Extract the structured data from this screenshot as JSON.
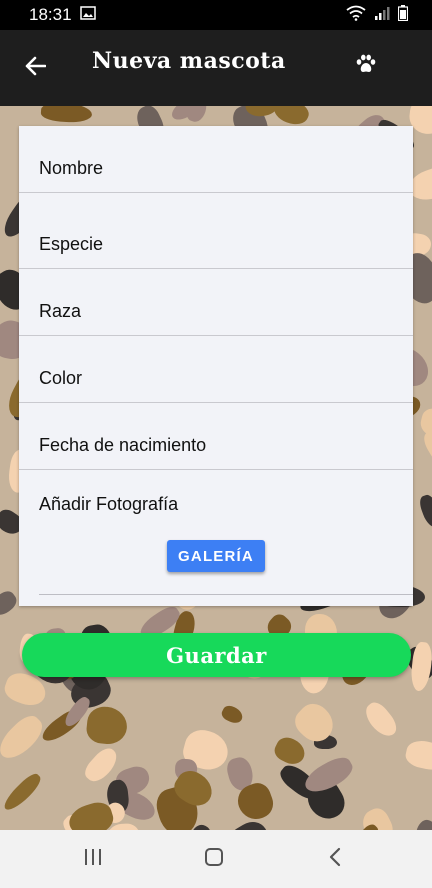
{
  "status_bar": {
    "time": "18:31",
    "icons": [
      "image-icon",
      "wifi-icon",
      "signal-icon",
      "battery-icon"
    ]
  },
  "app_bar": {
    "title": "Nueva mascota",
    "back_icon": "back-arrow-icon",
    "action_icon": "paw-icon"
  },
  "form": {
    "fields": [
      {
        "label": "Nombre"
      },
      {
        "label": "Especie"
      },
      {
        "label": "Raza"
      },
      {
        "label": "Color"
      },
      {
        "label": "Fecha de nacimiento"
      }
    ],
    "photo_label": "Añadir Fotografía",
    "gallery_button": "GALERÍA"
  },
  "save_button": "Guardar",
  "nav_bar": {
    "icons": [
      "recent-apps-icon",
      "home-icon",
      "back-icon"
    ]
  },
  "colors": {
    "app_bar": "#1e1e1e",
    "card": "#f2f3f8",
    "gallery_button": "#3d7ff4",
    "save_button": "#17d95a",
    "background": "#c6b39b"
  }
}
